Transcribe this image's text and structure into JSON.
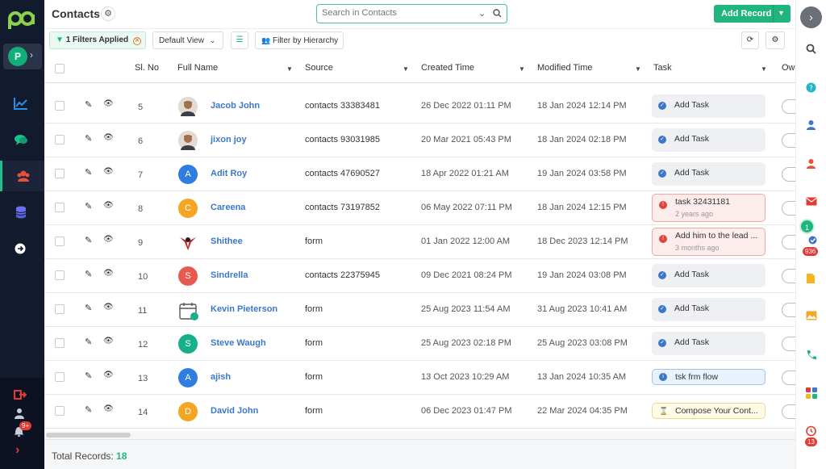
{
  "app": {
    "title": "Contacts",
    "account_initial": "P",
    "notif_count": "9+"
  },
  "search": {
    "placeholder": "Search in Contacts"
  },
  "actions": {
    "add_record": "Add Record"
  },
  "toolbar": {
    "filters_count": "1",
    "filters_label": "Filters Applied",
    "view_label": "Default View",
    "hierarchy_label": "Filter by Hierarchy"
  },
  "columns": {
    "sl_no": "Sl. No",
    "full_name": "Full Name",
    "source": "Source",
    "created": "Created Time",
    "modified": "Modified Time",
    "task": "Task",
    "owner": "Ow"
  },
  "rows": [
    {
      "sl": "5",
      "name": "Jacob John",
      "avatar": "photo",
      "source": "contacts 33383481",
      "created": "26 Dec 2022 01:11 PM",
      "modified": "18 Jan 2024 12:14 PM",
      "task": "Add Task",
      "task_type": "add",
      "task_sub": ""
    },
    {
      "sl": "6",
      "name": "jixon joy",
      "avatar": "photo",
      "source": "contacts 93031985",
      "created": "20 Mar 2021 05:43 PM",
      "modified": "18 Jan 2024 02:18 PM",
      "task": "Add Task",
      "task_type": "add",
      "task_sub": ""
    },
    {
      "sl": "7",
      "name": "Adit Roy",
      "avatar": "A",
      "avatar_color": "#2f7de1",
      "source": "contacts 47690527",
      "created": "18 Apr 2022 01:21 AM",
      "modified": "19 Jan 2024 03:58 PM",
      "task": "Add Task",
      "task_type": "add",
      "task_sub": ""
    },
    {
      "sl": "8",
      "name": "Careena",
      "avatar": "C",
      "avatar_color": "#f4a623",
      "source": "contacts 73197852",
      "created": "06 May 2022 07:11 PM",
      "modified": "18 Jan 2024 12:15 PM",
      "task": "task 32431181",
      "task_type": "warn",
      "task_sub": "2 years ago"
    },
    {
      "sl": "9",
      "name": "Shithee",
      "avatar": "logo",
      "source": "form",
      "created": "01 Jan 2022 12:00 AM",
      "modified": "18 Dec 2023 12:14 PM",
      "task": "Add him to the lead ...",
      "task_type": "warn",
      "task_sub": "3 months ago"
    },
    {
      "sl": "10",
      "name": "Sindrella",
      "avatar": "S",
      "avatar_color": "#e85a4f",
      "source": "contacts 22375945",
      "created": "09 Dec 2021 08:24 PM",
      "modified": "19 Jan 2024 03:08 PM",
      "task": "Add Task",
      "task_type": "add",
      "task_sub": ""
    },
    {
      "sl": "11",
      "name": "Kevin Pieterson",
      "avatar": "calendar",
      "source": "form",
      "created": "25 Aug 2023 11:54 AM",
      "modified": "31 Aug 2023 10:41 AM",
      "task": "Add Task",
      "task_type": "add",
      "task_sub": ""
    },
    {
      "sl": "12",
      "name": "Steve Waugh",
      "avatar": "S",
      "avatar_color": "#16b08a",
      "source": "form",
      "created": "25 Aug 2023 02:18 PM",
      "modified": "25 Aug 2023 03:08 PM",
      "task": "Add Task",
      "task_type": "add",
      "task_sub": ""
    },
    {
      "sl": "13",
      "name": "ajish",
      "avatar": "A",
      "avatar_color": "#2f7de1",
      "source": "form",
      "created": "13 Oct 2023 10:29 AM",
      "modified": "13 Jan 2024 10:35 AM",
      "task": "tsk frm flow",
      "task_type": "info",
      "task_sub": ""
    },
    {
      "sl": "14",
      "name": "David John",
      "avatar": "D",
      "avatar_color": "#f4a623",
      "source": "form",
      "created": "06 Dec 2023 01:47 PM",
      "modified": "22 Mar 2024 04:35 PM",
      "task": "Compose Your Cont...",
      "task_type": "pend",
      "task_sub": ""
    }
  ],
  "footer": {
    "label": "Total Records:",
    "count": "18"
  },
  "right_sidebar": {
    "green_badge": "1",
    "count_badge": "936",
    "reminder_badge": "13"
  },
  "colors": {
    "accent": "#1fb57d",
    "sidebar_bg": "#121a2e",
    "link": "#3d77c9"
  }
}
